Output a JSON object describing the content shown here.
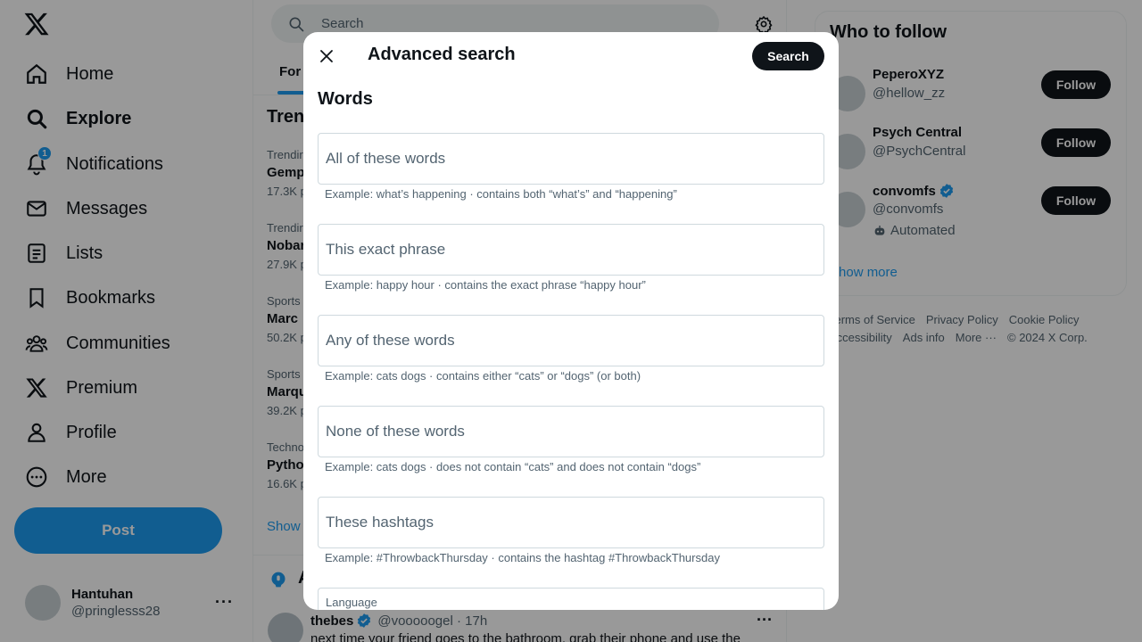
{
  "nav": {
    "items": [
      {
        "label": "Home",
        "icon": "home-icon"
      },
      {
        "label": "Explore",
        "icon": "search-icon"
      },
      {
        "label": "Notifications",
        "icon": "bell-icon",
        "badge": "1"
      },
      {
        "label": "Messages",
        "icon": "envelope-icon"
      },
      {
        "label": "Lists",
        "icon": "list-icon"
      },
      {
        "label": "Bookmarks",
        "icon": "bookmark-icon"
      },
      {
        "label": "Communities",
        "icon": "people-icon"
      },
      {
        "label": "Premium",
        "icon": "x-logo-icon"
      },
      {
        "label": "Profile",
        "icon": "person-icon"
      },
      {
        "label": "More",
        "icon": "more-circle-icon"
      }
    ],
    "post_label": "Post",
    "account": {
      "name": "Hantuhan",
      "handle": "@pringlesss28",
      "more": "···"
    }
  },
  "middle": {
    "search_placeholder": "Search",
    "tab_label": "For",
    "trends_title": "Tren",
    "trends": [
      {
        "category": "Trendir",
        "name": "Gemp",
        "count": "17.3K p"
      },
      {
        "category": "Trendir",
        "name": "Nobar",
        "count": "27.9K p"
      },
      {
        "category": "Sports",
        "name": "Marc",
        "count": "50.2K p"
      },
      {
        "category": "Sports",
        "name": "Marqu",
        "count": "39.2K p"
      },
      {
        "category": "Techno",
        "name": "Pytho",
        "count": "16.6K p"
      }
    ],
    "show_more": "Show",
    "spaces_letter": "A",
    "tweet": {
      "name": "thebes",
      "meta": "@vooooogel · 17h",
      "text": "next time your friend goes to the bathroom, grab their phone and use the",
      "more": "···"
    }
  },
  "right": {
    "wtf_title": "Who to follow",
    "accounts": [
      {
        "name": "PeperoXYZ",
        "handle": "@hellow_zz",
        "verified": false,
        "follow": "Follow"
      },
      {
        "name": "Psych Central",
        "handle": "@PsychCentral",
        "verified": false,
        "follow": "Follow"
      },
      {
        "name": "convomfs",
        "handle": "@convomfs",
        "verified": true,
        "automated": "Automated",
        "follow": "Follow"
      }
    ],
    "show_more": "Show more",
    "footer": {
      "terms": "Terms of Service",
      "privacy": "Privacy Policy",
      "cookie": "Cookie Policy",
      "accessibility": "Accessibility",
      "ads": "Ads info",
      "more": "More ···",
      "copyright": "© 2024 X Corp."
    }
  },
  "modal": {
    "title": "Advanced search",
    "search_label": "Search",
    "section_words": "Words",
    "fields": [
      {
        "placeholder": "All of these words",
        "hint": "Example: what’s happening · contains both “what’s” and “happening”"
      },
      {
        "placeholder": "This exact phrase",
        "hint": "Example: happy hour · contains the exact phrase “happy hour”"
      },
      {
        "placeholder": "Any of these words",
        "hint": "Example: cats dogs · contains either “cats” or “dogs” (or both)"
      },
      {
        "placeholder": "None of these words",
        "hint": "Example: cats dogs · does not contain “cats” and does not contain “dogs”"
      },
      {
        "placeholder": "These hashtags",
        "hint": "Example: #ThrowbackThursday · contains the hashtag #ThrowbackThursday"
      }
    ],
    "language_label": "Language"
  },
  "colors": {
    "accent": "#1d9bf0",
    "text": "#0f1419",
    "secondary": "#536471",
    "overlay": "rgba(0,0,0,0.4)"
  }
}
